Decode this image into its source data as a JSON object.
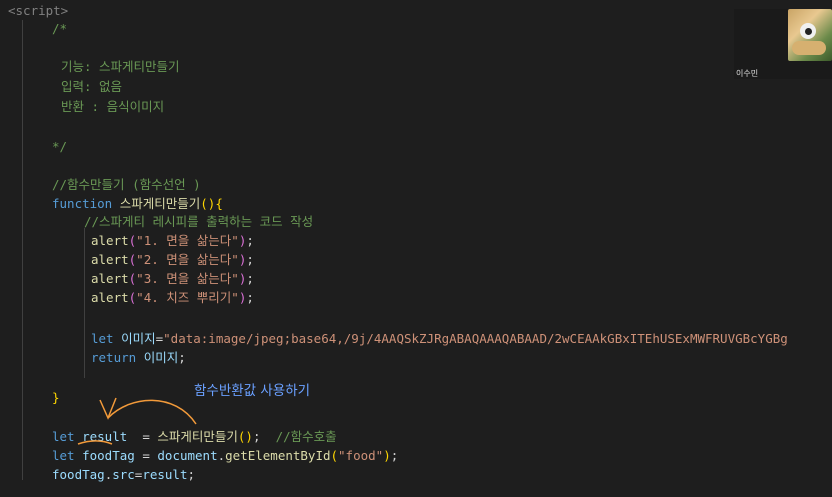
{
  "editor": {
    "line_script_tag": "<script>",
    "line_comment_open": "/*",
    "doc_func": "기능: 스파게티만들기",
    "doc_input": "입력: 없음",
    "doc_return": "반환 : 음식이미지",
    "line_comment_close": "*/",
    "comment_make_func": "//함수만들기 (함수선언 )",
    "kw_function": "function",
    "func_name": "스파게티만들기",
    "comment_recipe": "//스파게티 레시피를 출력하는 코드 작성",
    "alert_fn": "alert",
    "alert1": "\"1. 면을 삶는다\"",
    "alert2": "\"2. 면을 삶는다\"",
    "alert3": "\"3. 면을 삶는다\"",
    "alert4": "\"4. 치즈 뿌리기\"",
    "kw_let": "let",
    "var_image": "이미지",
    "image_data": "\"data:image/jpeg;base64,/9j/4AAQSkZJRgABAQAAAQABAAD/2wCEAAkGBxITEhUSExMWFRUVGBcYGBg",
    "kw_return": "return",
    "var_result": "result",
    "comment_call": "//함수호출",
    "var_foodtag": "foodTag",
    "doc_call": "document",
    "get_by_id": "getElementById",
    "food_str": "\"food\"",
    "prop_src": "src"
  },
  "annotation": {
    "text": "함수반환값 사용하기",
    "color": "#6aa0ff"
  },
  "video": {
    "name": "이수민"
  }
}
